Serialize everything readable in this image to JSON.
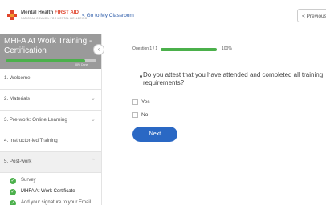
{
  "header": {
    "brand_prefix": "Mental Health ",
    "brand_accent": "FIRST AID",
    "brand_sub": "NATIONAL COUNCIL FOR MENTAL WELLBEING",
    "back_link": "< Go to My Classroom",
    "previous_label": "< Previous"
  },
  "colors": {
    "accent_green": "#4bb04b",
    "primary_blue": "#2a68c4",
    "brand_red": "#e0442b",
    "sidebar_header_bg": "#9a9a9a"
  },
  "sidebar": {
    "course_title": "MHFA At Work Training - Certification",
    "progress_text": "88% Done",
    "progress_fraction": 0.88,
    "collapse_icon": "chevron-left-icon",
    "items": [
      {
        "label": "1. Welcome"
      },
      {
        "label": "2. Materials"
      },
      {
        "label": "3. Pre-work: Online Learning"
      },
      {
        "label": "4. Instructor-led Training"
      },
      {
        "label": "5. Post-work"
      }
    ],
    "subitems": [
      {
        "label": "Survey"
      },
      {
        "label": "MHFA At Work Certificate"
      },
      {
        "label": "Add your signature to your Email"
      }
    ]
  },
  "main": {
    "question_counter": "Question 1 / 1",
    "question_progress_fraction": 1.0,
    "question_percent": "100%",
    "question_text": "Do you attest that you have attended and completed all training requirements?",
    "options": [
      {
        "label": "Yes"
      },
      {
        "label": "No"
      }
    ],
    "next_label": "Next"
  }
}
